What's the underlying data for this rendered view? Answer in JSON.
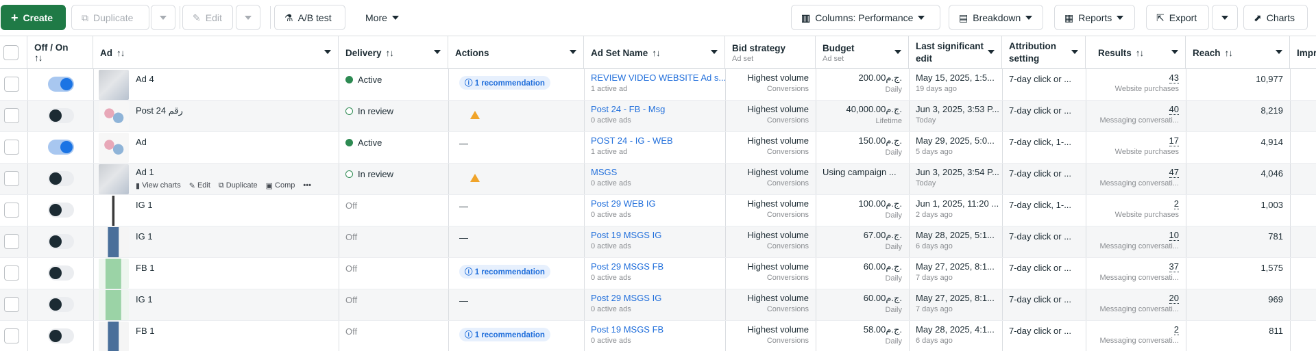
{
  "toolbar": {
    "create": "Create",
    "duplicate": "Duplicate",
    "edit": "Edit",
    "ab_test": "A/B test",
    "more": "More",
    "columns": "Columns: Performance",
    "breakdown": "Breakdown",
    "reports": "Reports",
    "export": "Export",
    "charts": "Charts"
  },
  "headers": {
    "off_on": "Off / On",
    "ad": "Ad",
    "delivery": "Delivery",
    "actions": "Actions",
    "adset_name": "Ad Set Name",
    "bid_strategy": "Bid strategy",
    "bid_strategy_sub": "Ad set",
    "budget": "Budget",
    "budget_sub": "Ad set",
    "last_edit": "Last significant edit",
    "attribution": "Attribution setting",
    "results": "Results",
    "reach": "Reach",
    "impressions": "Impre"
  },
  "hover_links": {
    "view_charts": "View charts",
    "edit": "Edit",
    "duplicate": "Duplicate",
    "compare": "Comp"
  },
  "rows": [
    {
      "on": true,
      "ad": "Ad 4",
      "thumb": "gray",
      "delivery": "Active",
      "delivery_type": "active",
      "action": "rec",
      "action_text": "1 recommendation",
      "adset": "REVIEW VIDEO WEBSITE Ad s...",
      "adset_sub": "1 active ad",
      "bid": "Highest volume",
      "bid_sub": "Conversions",
      "budget": "200.00ج.م.",
      "budget_sub": "Daily",
      "last_edit": "May 15, 2025, 1:5...",
      "last_sub": "19 days ago",
      "attribution": "7-day click or ...",
      "results": "43",
      "results_sub": "Website purchases",
      "reach": "10,977"
    },
    {
      "on": false,
      "ad": "Post 24 رقم",
      "thumb": "kids",
      "delivery": "In review",
      "delivery_type": "review",
      "action": "warn",
      "action_text": "",
      "adset": "Post 24 - FB - Msg",
      "adset_sub": "0 active ads",
      "bid": "Highest volume",
      "bid_sub": "Conversions",
      "budget": "40,000.00ج.م.",
      "budget_sub": "Lifetime",
      "last_edit": "Jun 3, 2025, 3:53 P...",
      "last_sub": "Today",
      "attribution": "7-day click or ...",
      "results": "40",
      "results_sub": "Messaging conversati...",
      "reach": "8,219"
    },
    {
      "on": true,
      "ad": "Ad",
      "thumb": "kids",
      "delivery": "Active",
      "delivery_type": "active",
      "action": "dash",
      "action_text": "—",
      "adset": "POST 24 - IG - WEB",
      "adset_sub": "1 active ad",
      "bid": "Highest volume",
      "bid_sub": "Conversions",
      "budget": "150.00ج.م.",
      "budget_sub": "Daily",
      "last_edit": "May 29, 2025, 5:0...",
      "last_sub": "5 days ago",
      "attribution": "7-day click, 1-...",
      "results": "17",
      "results_sub": "Website purchases",
      "reach": "4,914"
    },
    {
      "on": false,
      "ad": "Ad 1",
      "thumb": "gray",
      "delivery": "In review",
      "delivery_type": "review",
      "action": "warn",
      "action_text": "",
      "adset": "MSGS",
      "adset_sub": "0 active ads",
      "bid": "Highest volume",
      "bid_sub": "Conversions",
      "budget": "Using campaign ...",
      "budget_sub": "",
      "last_edit": "Jun 3, 2025, 3:54 P...",
      "last_sub": "Today",
      "attribution": "7-day click or ...",
      "results": "47",
      "results_sub": "Messaging conversati...",
      "reach": "4,046",
      "hover": true
    },
    {
      "on": false,
      "ad": "IG 1",
      "thumb": "stick",
      "delivery": "Off",
      "delivery_type": "off",
      "action": "dash",
      "action_text": "—",
      "adset": "Post 29 WEB IG",
      "adset_sub": "0 active ads",
      "bid": "Highest volume",
      "bid_sub": "Conversions",
      "budget": "100.00ج.م.",
      "budget_sub": "Daily",
      "last_edit": "Jun 1, 2025, 11:20 ...",
      "last_sub": "2 days ago",
      "attribution": "7-day click, 1-...",
      "results": "2",
      "results_sub": "Website purchases",
      "reach": "1,003"
    },
    {
      "on": false,
      "ad": "IG 1",
      "thumb": "person_blue",
      "delivery": "Off",
      "delivery_type": "off",
      "action": "dash",
      "action_text": "—",
      "adset": "Post 19 MSGS IG",
      "adset_sub": "0 active ads",
      "bid": "Highest volume",
      "bid_sub": "Conversions",
      "budget": "67.00ج.م.",
      "budget_sub": "Daily",
      "last_edit": "May 28, 2025, 5:1...",
      "last_sub": "6 days ago",
      "attribution": "7-day click or ...",
      "results": "10",
      "results_sub": "Messaging conversati...",
      "reach": "781"
    },
    {
      "on": false,
      "ad": "FB 1",
      "thumb": "person_green",
      "delivery": "Off",
      "delivery_type": "off",
      "action": "rec",
      "action_text": "1 recommendation",
      "adset": "Post 29 MSGS FB",
      "adset_sub": "0 active ads",
      "bid": "Highest volume",
      "bid_sub": "Conversions",
      "budget": "60.00ج.م.",
      "budget_sub": "Daily",
      "last_edit": "May 27, 2025, 8:1...",
      "last_sub": "7 days ago",
      "attribution": "7-day click or ...",
      "results": "37",
      "results_sub": "Messaging conversati...",
      "reach": "1,575"
    },
    {
      "on": false,
      "ad": "IG 1",
      "thumb": "person_green",
      "delivery": "Off",
      "delivery_type": "off",
      "action": "dash",
      "action_text": "—",
      "adset": "Post 29 MSGS IG",
      "adset_sub": "0 active ads",
      "bid": "Highest volume",
      "bid_sub": "Conversions",
      "budget": "60.00ج.م.",
      "budget_sub": "Daily",
      "last_edit": "May 27, 2025, 8:1...",
      "last_sub": "7 days ago",
      "attribution": "7-day click or ...",
      "results": "20",
      "results_sub": "Messaging conversati...",
      "reach": "969"
    },
    {
      "on": false,
      "ad": "FB 1",
      "thumb": "person_blue",
      "delivery": "Off",
      "delivery_type": "off",
      "action": "rec",
      "action_text": "1 recommendation",
      "adset": "Post 19 MSGS FB",
      "adset_sub": "0 active ads",
      "bid": "Highest volume",
      "bid_sub": "Conversions",
      "budget": "58.00ج.م.",
      "budget_sub": "Daily",
      "last_edit": "May 28, 2025, 4:1...",
      "last_sub": "6 days ago",
      "attribution": "7-day click or ...",
      "results": "2",
      "results_sub": "Messaging conversati...",
      "reach": "811"
    }
  ]
}
